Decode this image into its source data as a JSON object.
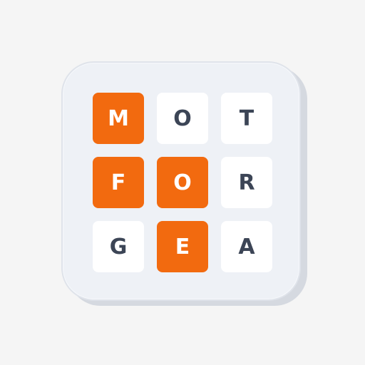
{
  "board": {
    "rows": [
      [
        {
          "letter": "M",
          "selected": true
        },
        {
          "letter": "O",
          "selected": false
        },
        {
          "letter": "T",
          "selected": false
        }
      ],
      [
        {
          "letter": "F",
          "selected": true
        },
        {
          "letter": "O",
          "selected": true
        },
        {
          "letter": "R",
          "selected": false
        }
      ],
      [
        {
          "letter": "G",
          "selected": false
        },
        {
          "letter": "E",
          "selected": true
        },
        {
          "letter": "A",
          "selected": false
        }
      ]
    ]
  },
  "colors": {
    "selected_tile": "#f26a0f",
    "tile": "#ffffff",
    "letter": "#3c4556",
    "board": "#eef1f6"
  }
}
